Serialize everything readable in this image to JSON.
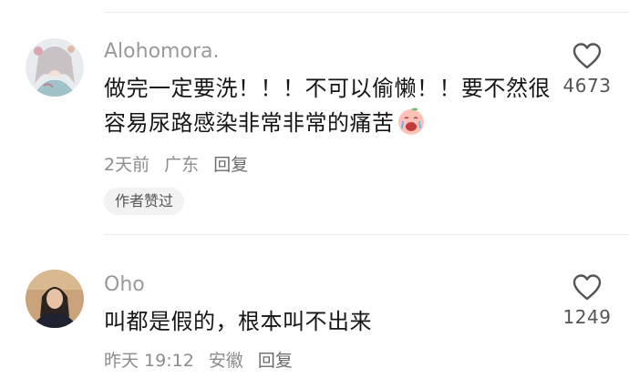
{
  "comments": [
    {
      "username": "Alohomora.",
      "text": "做完一定要洗！！！不可以偷懒！！要不然很容易尿路感染非常非常的痛苦",
      "emoji": "crying-peach-face-emoji",
      "time": "2天前",
      "location": "广东",
      "reply_label": "回复",
      "badge": "作者赞过",
      "like_count": "4673",
      "like_icon": "heart-outline-icon"
    },
    {
      "username": "Oho",
      "text": "叫都是假的，根本叫不出来",
      "time": "昨天 19:12",
      "location": "安徽",
      "reply_label": "回复",
      "like_count": "1249",
      "like_icon": "heart-outline-icon"
    }
  ],
  "colors": {
    "username": "#9a9a9a",
    "text": "#161616",
    "meta": "#8c8c8c",
    "badge_bg": "#f2f2f2",
    "divider": "#ececec"
  }
}
